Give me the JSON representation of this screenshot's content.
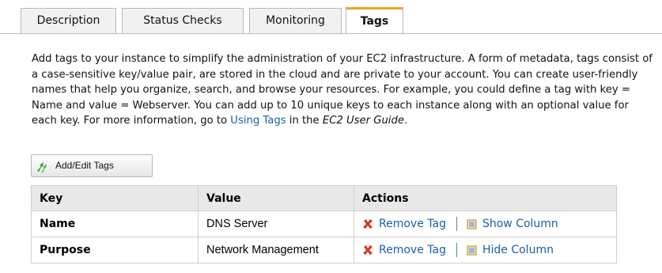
{
  "tabs": {
    "description": "Description",
    "status_checks": "Status Checks",
    "monitoring": "Monitoring",
    "tags": "Tags",
    "active": "Tags"
  },
  "description": {
    "text_before_link": "Add tags to your instance to simplify the administration of your EC2 infrastructure. A form of metadata, tags consist of a case-sensitive key/value pair, are stored in the cloud and are private to your account. You can create user-friendly names that help you organize, search, and browse your resources. For example, you could define a tag with key = Name and value = Webserver. You can add up to 10 unique keys to each instance along with an optional value for each key. For more information, go to ",
    "link_text": "Using Tags",
    "text_middle": " in the ",
    "guide_text": "EC2 User Guide",
    "text_end": "."
  },
  "toolbar": {
    "add_edit_label": "Add/Edit Tags",
    "icon": "green-arrows-icon"
  },
  "table": {
    "headers": {
      "key": "Key",
      "value": "Value",
      "actions": "Actions"
    },
    "rows": [
      {
        "key": "Name",
        "value": "DNS Server",
        "remove_label": "Remove Tag",
        "column_action": "Show Column"
      },
      {
        "key": "Purpose",
        "value": "Network Management",
        "remove_label": "Remove Tag",
        "column_action": "Hide Column"
      }
    ]
  },
  "colors": {
    "active_tab_accent": "#f0a31c",
    "link": "#1b5fa8",
    "remove_icon": "#d9341c"
  }
}
